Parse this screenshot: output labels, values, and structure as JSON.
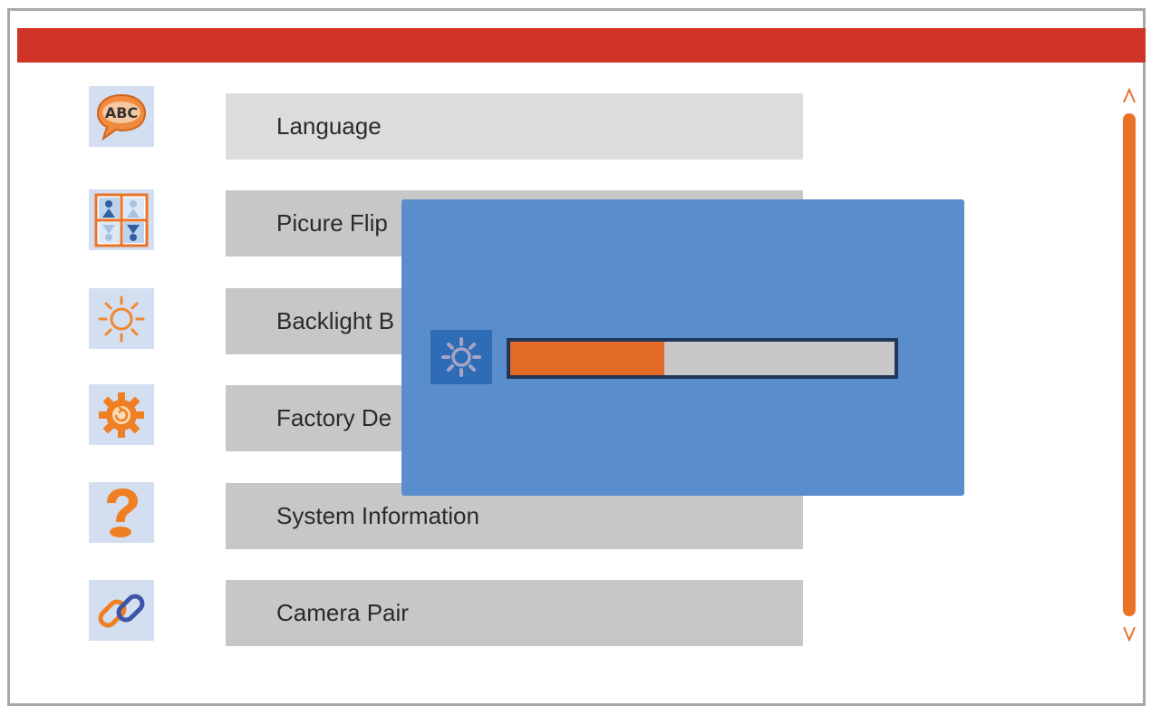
{
  "header": {
    "color": "#cf3426"
  },
  "menu": {
    "items": [
      {
        "label": "Language",
        "icon": "abc-speech-bubble-icon",
        "selected": true
      },
      {
        "label": "Picure Flip",
        "icon": "picture-flip-icon",
        "selected": false
      },
      {
        "label": "Backlight B",
        "icon": "sun-brightness-icon",
        "selected": false
      },
      {
        "label": "Factory De",
        "icon": "gear-reset-icon",
        "selected": false
      },
      {
        "label": "System Information",
        "icon": "question-mark-icon",
        "selected": false
      },
      {
        "label": "Camera Pair",
        "icon": "chain-link-icon",
        "selected": false
      }
    ]
  },
  "scrollbar": {
    "up_symbol": "^",
    "down_symbol": "v",
    "color": "#e97428"
  },
  "popup": {
    "icon": "brightness-icon",
    "level": 0.4,
    "fill_color": "#e46b26",
    "background_color": "#5a8dcb"
  }
}
